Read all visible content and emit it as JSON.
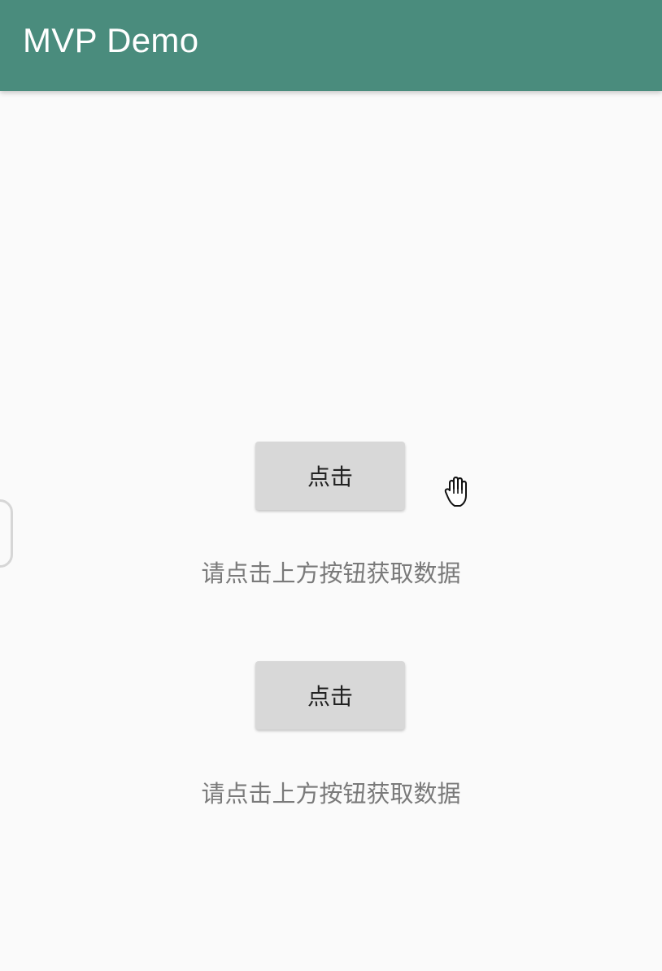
{
  "app": {
    "title": "MVP Demo",
    "accent_color": "#4a8c7d"
  },
  "sections": [
    {
      "button_label": "点击",
      "message": "请点击上方按钮获取数据"
    },
    {
      "button_label": "点击",
      "message": "请点击上方按钮获取数据"
    }
  ],
  "cursor": {
    "icon": "hand-cursor-icon"
  }
}
